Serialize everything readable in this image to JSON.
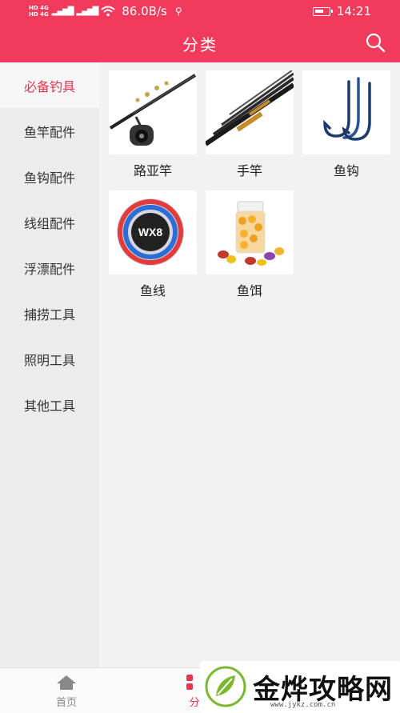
{
  "status": {
    "sim1": "HD 4G",
    "sim2": "HD 4G",
    "speed": "86.0B/s",
    "time": "14:21"
  },
  "header": {
    "title": "分类"
  },
  "sidebar": {
    "items": [
      {
        "label": "必备钓具"
      },
      {
        "label": "鱼竿配件"
      },
      {
        "label": "鱼钩配件"
      },
      {
        "label": "线组配件"
      },
      {
        "label": "浮漂配件"
      },
      {
        "label": "捕捞工具"
      },
      {
        "label": "照明工具"
      },
      {
        "label": "其他工具"
      }
    ]
  },
  "products": [
    {
      "label": "路亚竿",
      "icon": "spinning-rod-reel-image"
    },
    {
      "label": "手竿",
      "icon": "hand-rod-image"
    },
    {
      "label": "鱼钩",
      "icon": "fish-hooks-image"
    },
    {
      "label": "鱼线",
      "icon": "fishing-line-spool-image"
    },
    {
      "label": "鱼饵",
      "icon": "bait-jar-image"
    }
  ],
  "tabbar": {
    "home": "首页",
    "category": "分"
  },
  "watermark": {
    "brand": "金烨攻略网",
    "url": "www.jykz.com.cn"
  },
  "colors": {
    "accent": "#f23b5c",
    "active_text": "#e8344e"
  }
}
